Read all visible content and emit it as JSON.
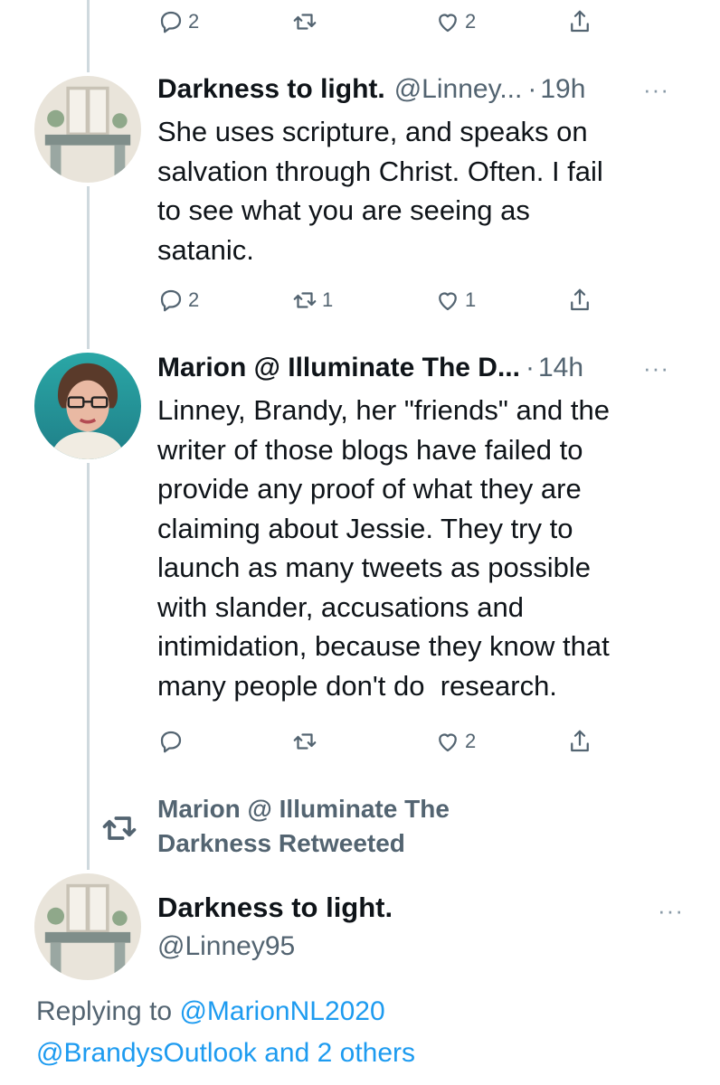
{
  "top_actions": {
    "reply_count": "2",
    "retweet_count": "",
    "like_count": "2"
  },
  "tweet1": {
    "name": "Darkness to light.",
    "handle": "@Linney...",
    "time": "19h",
    "more": "···",
    "body": "She uses scripture, and speaks on\nsalvation through Christ. Often. I fail\nto see what you are seeing as\nsatanic.",
    "reply_count": "2",
    "retweet_count": "1",
    "like_count": "1"
  },
  "tweet2": {
    "name": "Marion @ Illuminate The D...",
    "time": "14h",
    "more": "···",
    "body": "Linney, Brandy, her \"friends\" and the\nwriter of those blogs have failed to\nprovide any proof of what they are\nclaiming about Jessie. They try to\nlaunch as many tweets as possible\nwith slander, accusations and\nintimidation, because they know that\nmany people don't do  research.",
    "reply_count": "",
    "retweet_count": "",
    "like_count": "2"
  },
  "retweeted": {
    "line1": "Marion @ Illuminate The",
    "line2": "Darkness Retweeted"
  },
  "tweet3": {
    "name": "Darkness to light.",
    "handle": "@Linney95",
    "more": "···",
    "replying_prefix": "Replying to ",
    "replying_to_1": "@MarionNL2020",
    "replying_to_2": "@BrandysOutlook",
    "replying_suffix": " and 2 others"
  },
  "icons": [
    "reply-icon",
    "retweet-icon",
    "like-icon",
    "share-icon",
    "more-icon"
  ],
  "colors": {
    "link": "#1d9bf0",
    "muted": "#536471",
    "thread_line": "#cfd9de"
  }
}
